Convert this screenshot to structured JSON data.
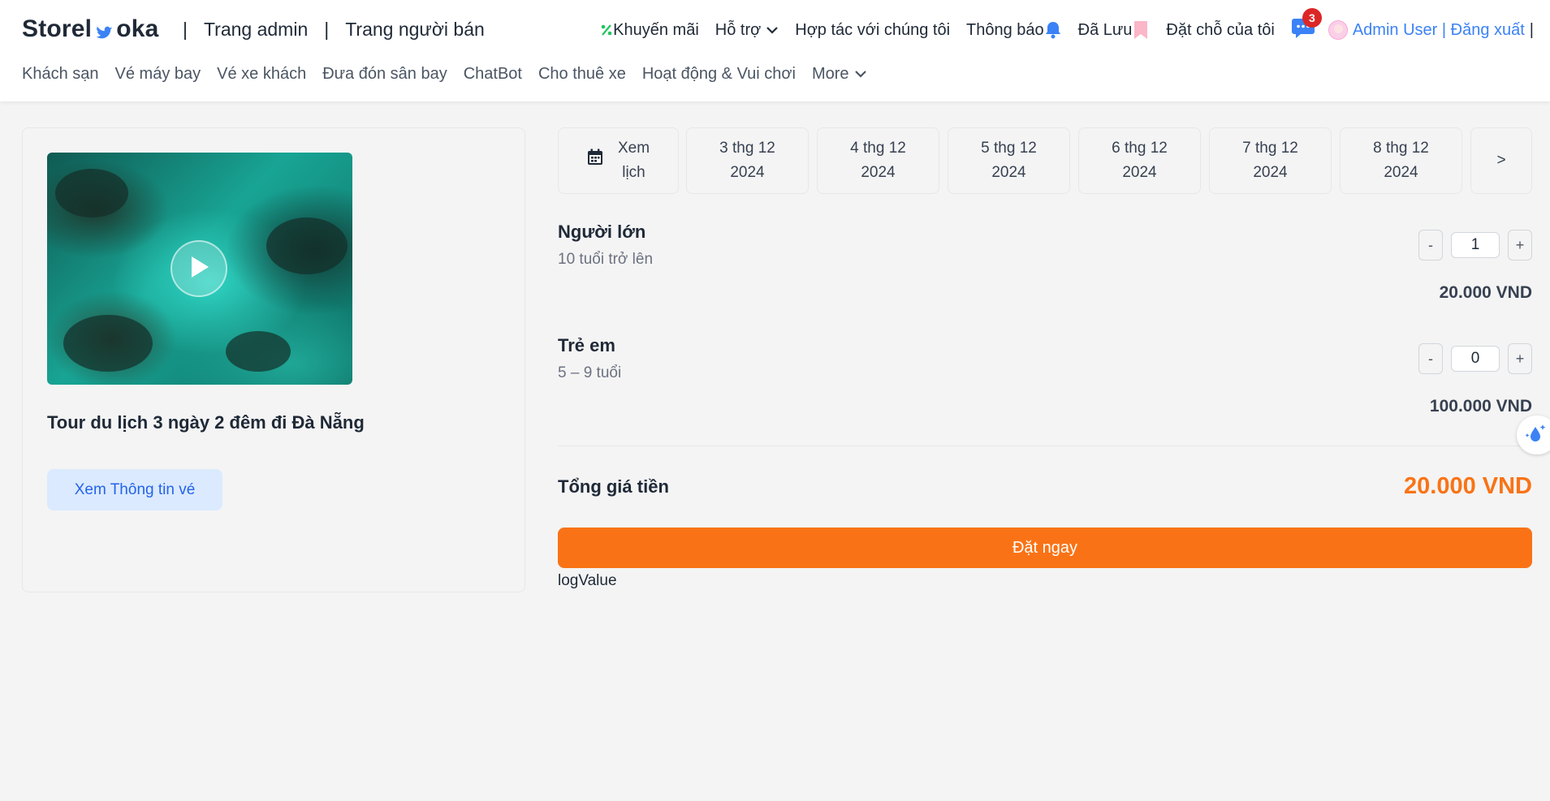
{
  "header": {
    "logo_left": "Storel",
    "logo_right": "oka",
    "top_links": [
      "Trang admin",
      "Trang người bán"
    ],
    "separator": "|",
    "promo_label": "Khuyến mãi",
    "support_label": "Hỗ trợ",
    "partner_label": "Hợp tác với chúng tôi",
    "notify_label": "Thông báo",
    "saved_label": "Đã Lưu",
    "bookings_label": "Đặt chỗ của tôi",
    "chat_badge": "3",
    "user_label": "Admin User | Đăng xuất",
    "trailing_bar": "|"
  },
  "categories": [
    "Khách sạn",
    "Vé máy bay",
    "Vé xe khách",
    "Đưa đón sân bay",
    "ChatBot",
    "Cho thuê xe",
    "Hoạt động & Vui chơi"
  ],
  "more_label": "More",
  "tour": {
    "title": "Tour du lịch 3 ngày 2 đêm đi Đà Nẵng",
    "info_button": "Xem Thông tin vé"
  },
  "dates": {
    "calendar_line1": "Xem",
    "calendar_line2": "lịch",
    "items": [
      {
        "day": "3 thg 12",
        "year": "2024"
      },
      {
        "day": "4 thg 12",
        "year": "2024"
      },
      {
        "day": "5 thg 12",
        "year": "2024"
      },
      {
        "day": "6 thg 12",
        "year": "2024"
      },
      {
        "day": "7 thg 12",
        "year": "2024"
      },
      {
        "day": "8 thg 12",
        "year": "2024"
      }
    ],
    "next_label": ">"
  },
  "tickets": [
    {
      "label": "Người lớn",
      "sub": "10 tuổi trở lên",
      "quantity": "1",
      "price": "20.000 VND"
    },
    {
      "label": "Trẻ em",
      "sub": "5 – 9 tuổi",
      "quantity": "0",
      "price": "100.000 VND"
    }
  ],
  "stepper": {
    "minus": "-",
    "plus": "+"
  },
  "total": {
    "label": "Tổng giá tiền",
    "value": "20.000 VND"
  },
  "book_button": "Đặt ngay",
  "log_text": "logValue",
  "colors": {
    "accent": "#f97316",
    "link": "#3b82f6",
    "info_bg": "#dbeafe",
    "badge": "#dc2626"
  }
}
